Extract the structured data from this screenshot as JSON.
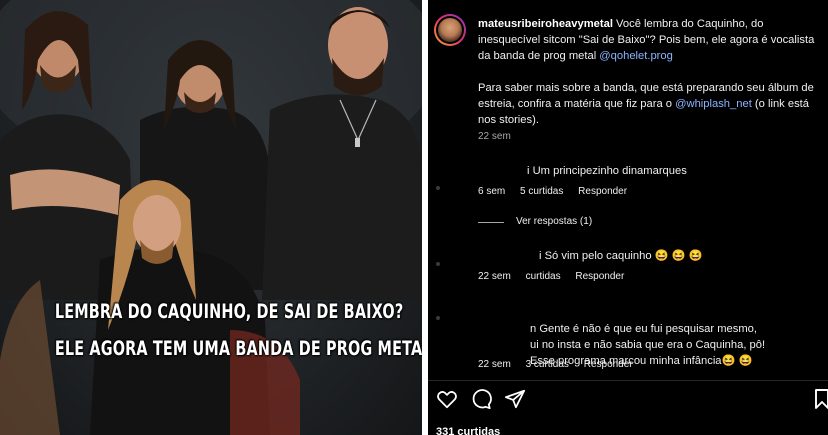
{
  "photo": {
    "caption_line1": "LEMBRA DO CAQUINHO, DE SAI DE BAIXO?",
    "caption_line2": "ELE AGORA TEM UMA BANDA DE PROG METAL"
  },
  "post": {
    "username": "mateusribeiroheavymetal",
    "text_1a": " Você lembra do Caquinho, do inesquecível sitcom \"Sai de Baixo\"? Pois bem, ele agora é vocalista da banda de prog metal ",
    "mention_1": "@qohelet.prog",
    "text_2a": "Para saber mais sobre a banda, que está preparando seu álbum de estreia, confira a matéria que fiz para o ",
    "mention_2": "@whiplash_net",
    "text_2b": " (o link está nos stories).",
    "time": "22 sem"
  },
  "comments": [
    {
      "text": "i Um principezinho dinamarques",
      "time": "6 sem",
      "likes": "5 curtidas",
      "reply": "Responder"
    },
    {
      "text": "i Só vim pelo caquinho 😆 😆 😆",
      "time": "22 sem",
      "likes": "curtidas",
      "reply": "Responder"
    },
    {
      "text": "n Gente é não é que eu fui pesquisar mesmo,\nui no insta e não sabia que era o Caquinha, pô!\nEsse programa marcou minha infância😆 😆",
      "time": "22 sem",
      "likes": "3 curtidas",
      "reply": "Responder"
    }
  ],
  "view_replies": "Ver respostas (1)",
  "footer": {
    "likes": "331 curtidas"
  },
  "icons": {
    "like": "heart-icon",
    "comment": "comment-icon",
    "share": "share-icon",
    "save": "bookmark-icon"
  },
  "colors": {
    "link": "#8cb4ff",
    "meta": "#a8a8a8",
    "background": "#000000"
  }
}
